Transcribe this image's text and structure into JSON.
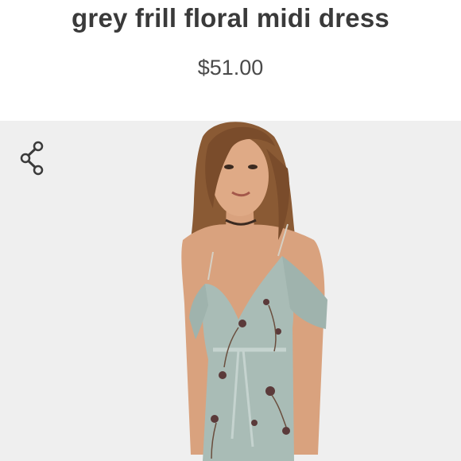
{
  "product": {
    "title": "grey frill floral midi dress",
    "price": "$51.00"
  },
  "icons": {
    "share": "share-icon"
  },
  "colors": {
    "text": "#3a3a3a",
    "photo_background": "#efefef",
    "dress": "#a9bcb6"
  }
}
